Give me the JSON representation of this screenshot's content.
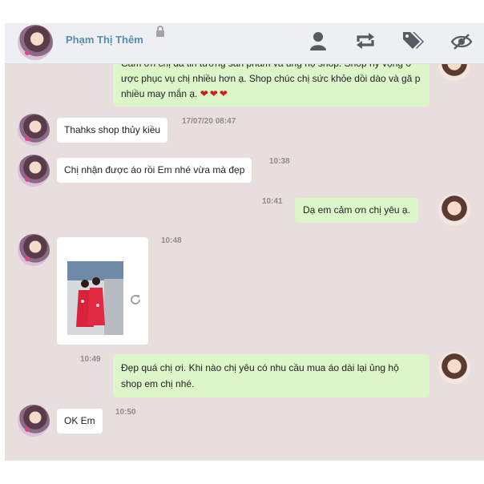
{
  "header": {
    "contact_name": "Phạm Thị Thêm",
    "icons": [
      "lock-icon",
      "user-icon",
      "repeat-icon",
      "tags-icon",
      "eye-slash-icon"
    ]
  },
  "messages": [
    {
      "from": "shop",
      "text": "Cảm ơn chị đã tin tưởng sản phẩm và ủng hộ shop. Shop hy vọng ở ược phục vụ chị nhiều hơn ạ. Shop chúc chị sức khỏe dồi dào và gă p nhiều may mắn ạ.",
      "hearts": "❤❤❤"
    },
    {
      "from": "customer",
      "text": "Thahks shop thủy kiều",
      "time": "17/07/20 08:47"
    },
    {
      "from": "customer",
      "text": "Chị nhận được áo rồi Em nhé vừa mà đẹp",
      "time": "10:38"
    },
    {
      "from": "shop",
      "text": "Dạ em cảm ơn chị yêu ạ.",
      "time": "10:41"
    },
    {
      "from": "customer",
      "type": "image",
      "time": "10:48"
    },
    {
      "from": "shop",
      "text": "Đẹp quá chị ơi. Khi nào chị yêu có nhu cầu mua áo dài lại ủng hộ shop em chị nhé.",
      "time": "10:49"
    },
    {
      "from": "customer",
      "text": "OK Em",
      "time": "10:50"
    }
  ],
  "colors": {
    "chat_bg": "#e8dedd",
    "header_bg": "#eeeff2",
    "name_color": "#5a8bb0",
    "outgoing_bubble": "#dcf5c9",
    "incoming_bubble": "#ffffff",
    "heart": "#cc1b22"
  }
}
